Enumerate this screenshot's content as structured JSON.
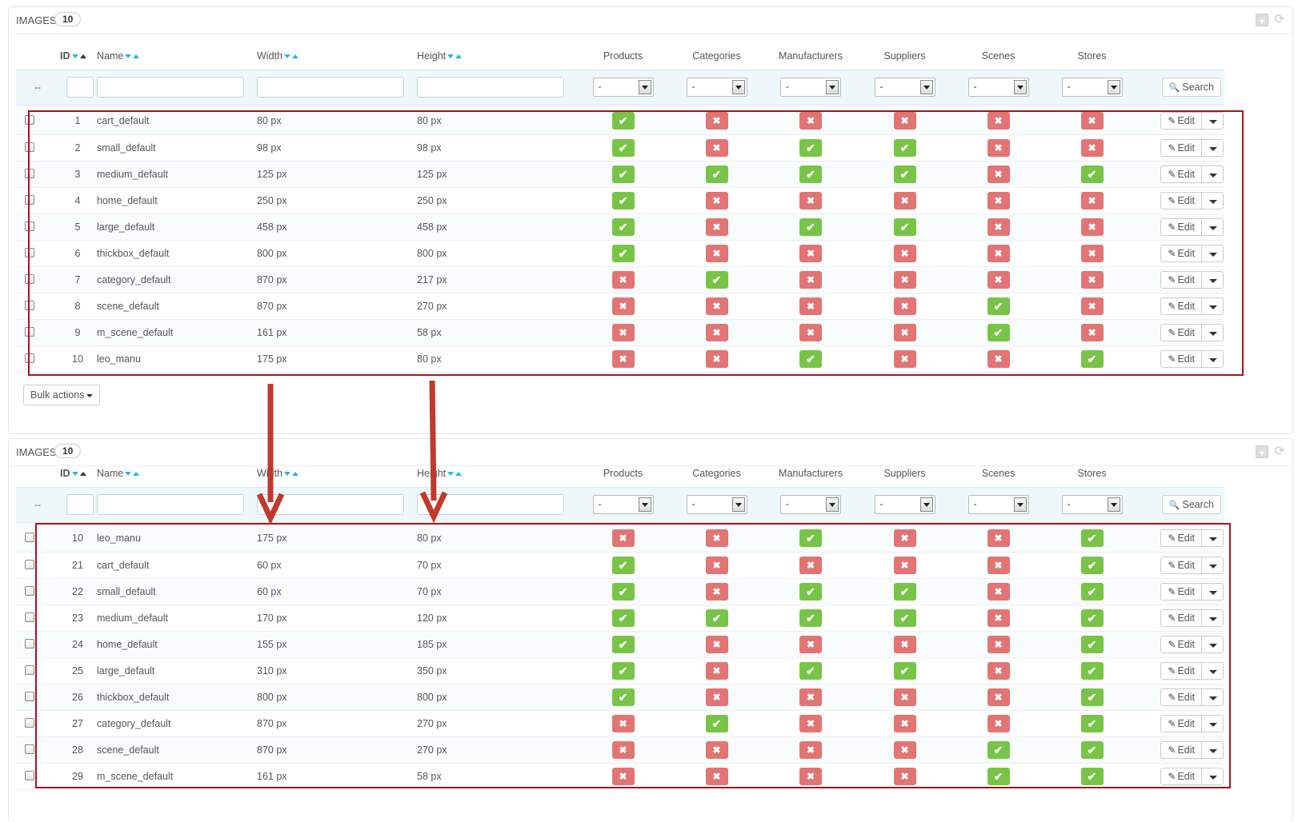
{
  "panels": [
    {
      "title": "IMAGES",
      "count": "10",
      "columns": {
        "id": "ID",
        "name": "Name",
        "width": "Width",
        "height": "Height",
        "products": "Products",
        "categories": "Categories",
        "manufacturers": "Manufacturers",
        "suppliers": "Suppliers",
        "scenes": "Scenes",
        "stores": "Stores"
      },
      "filter": {
        "reset": "--",
        "select_value": "-",
        "search_label": "Search"
      },
      "rows": [
        {
          "id": "1",
          "name": "cart_default",
          "width": "80 px",
          "height": "80 px",
          "products": true,
          "categories": false,
          "manufacturers": false,
          "suppliers": false,
          "scenes": false,
          "stores": false
        },
        {
          "id": "2",
          "name": "small_default",
          "width": "98 px",
          "height": "98 px",
          "products": true,
          "categories": false,
          "manufacturers": true,
          "suppliers": true,
          "scenes": false,
          "stores": false
        },
        {
          "id": "3",
          "name": "medium_default",
          "width": "125 px",
          "height": "125 px",
          "products": true,
          "categories": true,
          "manufacturers": true,
          "suppliers": true,
          "scenes": false,
          "stores": true
        },
        {
          "id": "4",
          "name": "home_default",
          "width": "250 px",
          "height": "250 px",
          "products": true,
          "categories": false,
          "manufacturers": false,
          "suppliers": false,
          "scenes": false,
          "stores": false
        },
        {
          "id": "5",
          "name": "large_default",
          "width": "458 px",
          "height": "458 px",
          "products": true,
          "categories": false,
          "manufacturers": true,
          "suppliers": true,
          "scenes": false,
          "stores": false
        },
        {
          "id": "6",
          "name": "thickbox_default",
          "width": "800 px",
          "height": "800 px",
          "products": true,
          "categories": false,
          "manufacturers": false,
          "suppliers": false,
          "scenes": false,
          "stores": false
        },
        {
          "id": "7",
          "name": "category_default",
          "width": "870 px",
          "height": "217 px",
          "products": false,
          "categories": true,
          "manufacturers": false,
          "suppliers": false,
          "scenes": false,
          "stores": false
        },
        {
          "id": "8",
          "name": "scene_default",
          "width": "870 px",
          "height": "270 px",
          "products": false,
          "categories": false,
          "manufacturers": false,
          "suppliers": false,
          "scenes": true,
          "stores": false
        },
        {
          "id": "9",
          "name": "m_scene_default",
          "width": "161 px",
          "height": "58 px",
          "products": false,
          "categories": false,
          "manufacturers": false,
          "suppliers": false,
          "scenes": true,
          "stores": false
        },
        {
          "id": "10",
          "name": "leo_manu",
          "width": "175 px",
          "height": "80 px",
          "products": false,
          "categories": false,
          "manufacturers": true,
          "suppliers": false,
          "scenes": false,
          "stores": true
        }
      ],
      "edit_label": "Edit",
      "bulk_label": "Bulk actions"
    },
    {
      "title": "IMAGES",
      "count": "10",
      "columns": {
        "id": "ID",
        "name": "Name",
        "width": "Width",
        "height": "Height",
        "products": "Products",
        "categories": "Categories",
        "manufacturers": "Manufacturers",
        "suppliers": "Suppliers",
        "scenes": "Scenes",
        "stores": "Stores"
      },
      "filter": {
        "reset": "--",
        "select_value": "-",
        "search_label": "Search"
      },
      "rows": [
        {
          "id": "10",
          "name": "leo_manu",
          "width": "175 px",
          "height": "80 px",
          "products": false,
          "categories": false,
          "manufacturers": true,
          "suppliers": false,
          "scenes": false,
          "stores": true
        },
        {
          "id": "21",
          "name": "cart_default",
          "width": "60 px",
          "height": "70 px",
          "products": true,
          "categories": false,
          "manufacturers": false,
          "suppliers": false,
          "scenes": false,
          "stores": true
        },
        {
          "id": "22",
          "name": "small_default",
          "width": "60 px",
          "height": "70 px",
          "products": true,
          "categories": false,
          "manufacturers": true,
          "suppliers": true,
          "scenes": false,
          "stores": true
        },
        {
          "id": "23",
          "name": "medium_default",
          "width": "170 px",
          "height": "120 px",
          "products": true,
          "categories": true,
          "manufacturers": true,
          "suppliers": true,
          "scenes": false,
          "stores": true
        },
        {
          "id": "24",
          "name": "home_default",
          "width": "155 px",
          "height": "185 px",
          "products": true,
          "categories": false,
          "manufacturers": false,
          "suppliers": false,
          "scenes": false,
          "stores": true
        },
        {
          "id": "25",
          "name": "large_default",
          "width": "310 px",
          "height": "350 px",
          "products": true,
          "categories": false,
          "manufacturers": true,
          "suppliers": true,
          "scenes": false,
          "stores": true
        },
        {
          "id": "26",
          "name": "thickbox_default",
          "width": "800 px",
          "height": "800 px",
          "products": true,
          "categories": false,
          "manufacturers": false,
          "suppliers": false,
          "scenes": false,
          "stores": true
        },
        {
          "id": "27",
          "name": "category_default",
          "width": "870 px",
          "height": "270 px",
          "products": false,
          "categories": true,
          "manufacturers": false,
          "suppliers": false,
          "scenes": false,
          "stores": true
        },
        {
          "id": "28",
          "name": "scene_default",
          "width": "870 px",
          "height": "270 px",
          "products": false,
          "categories": false,
          "manufacturers": false,
          "suppliers": false,
          "scenes": true,
          "stores": true
        },
        {
          "id": "29",
          "name": "m_scene_default",
          "width": "161 px",
          "height": "58 px",
          "products": false,
          "categories": false,
          "manufacturers": false,
          "suppliers": false,
          "scenes": true,
          "stores": true
        }
      ],
      "edit_label": "Edit"
    }
  ],
  "colors": {
    "yes": "#78c447",
    "no": "#e27474",
    "annotation": "#a8151c",
    "arrow": "#c0392b"
  }
}
